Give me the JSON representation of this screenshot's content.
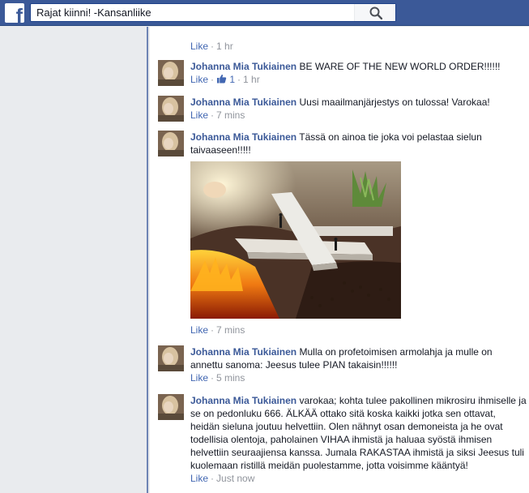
{
  "header": {
    "search_value": "Rajat kiinni! -Kansanliike",
    "logo_glyph": "f",
    "search_icon": "magnifier-icon"
  },
  "colors": {
    "brand_blue": "#3b5998",
    "link_blue": "#4267b2",
    "meta_gray": "#90949c",
    "page_bg": "#e9ebee"
  },
  "comments": [
    {
      "author": "",
      "text": "",
      "like": "Like",
      "time": "1 hr",
      "likes": ""
    },
    {
      "author": "Johanna Mia Tukiainen",
      "text": "BE WARE OF THE NEW WORLD ORDER!!!!!!",
      "like": "Like",
      "time": "1 hr",
      "likes": "1"
    },
    {
      "author": "Johanna Mia Tukiainen",
      "text": "Uusi maailmanjärjestys on tulossa! Varokaa!",
      "like": "Like",
      "time": "7 mins",
      "likes": ""
    },
    {
      "author": "Johanna Mia Tukiainen",
      "text": "Tässä on ainoa tie joka voi pelastaa sielun taivaaseen!!!!!",
      "like": "Like",
      "time": "7 mins",
      "likes": ""
    },
    {
      "author": "Johanna Mia Tukiainen",
      "text": "Mulla on profetoimisen armolahja ja mulle on annettu sanoma: Jeesus tulee PIAN takaisin!!!!!!",
      "like": "Like",
      "time": "5 mins",
      "likes": ""
    },
    {
      "author": "Johanna Mia Tukiainen",
      "text": "varokaa; kohta tulee pakollinen mikrosiru ihmiselle ja se on pedonluku 666. ÄLKÄÄ ottako sitä koska kaikki jotka sen ottavat, heidän sieluna joutuu helvettiin. Olen nähnyt osan demoneista ja he ovat todellisia olentoja, paholainen VIHAA ihmistä ja haluaa syöstä ihmisen helvettiin seuraajiensa kanssa. Jumala RAKASTAA ihmistä ja siksi Jeesus tuli kuolemaan ristillä meidän puolestamme, jotta voisimme kääntyä!",
      "like": "Like",
      "time": "Just now",
      "likes": ""
    }
  ]
}
